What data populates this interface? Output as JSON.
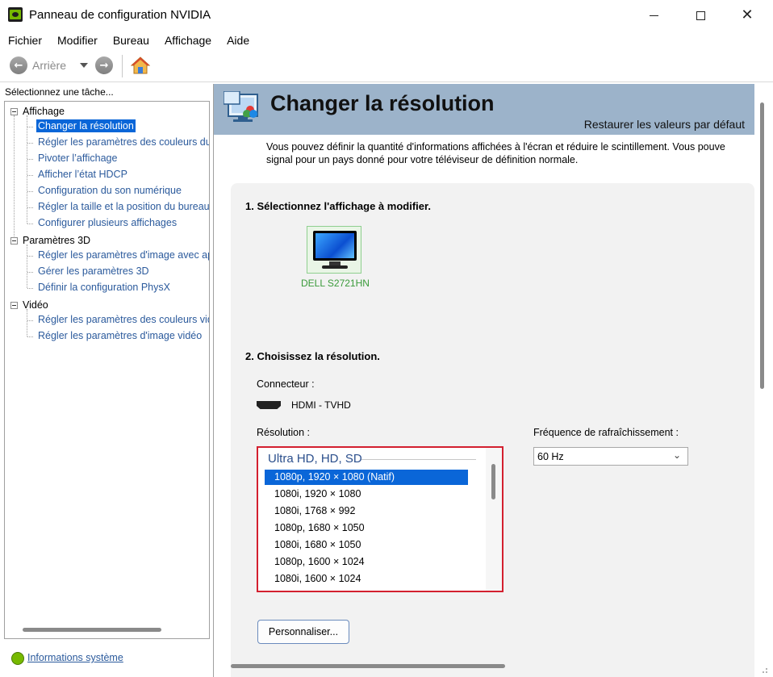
{
  "window": {
    "title": "Panneau de configuration NVIDIA",
    "minimize_icon": "minimize-icon",
    "maximize_icon": "maximize-icon",
    "close_icon": "close-icon"
  },
  "menu": [
    "Fichier",
    "Modifier",
    "Bureau",
    "Affichage",
    "Aide"
  ],
  "toolbar": {
    "back_label": "Arrière",
    "back_icon": "arrow-left-icon",
    "forward_icon": "arrow-right-icon",
    "home_icon": "home-icon"
  },
  "sidebar": {
    "header": "Sélectionnez une tâche...",
    "groups": [
      {
        "label": "Affichage",
        "items": [
          "Changer la résolution",
          "Régler les paramètres des couleurs du bureau",
          "Pivoter l’affichage",
          "Afficher l’état HDCP",
          "Configuration du son numérique",
          "Régler la taille et la position du bureau",
          "Configurer plusieurs affichages"
        ]
      },
      {
        "label": "Paramètres 3D",
        "items": [
          "Régler les paramètres d'image avec aperçu",
          "Gérer les paramètres 3D",
          "Définir la configuration PhysX"
        ]
      },
      {
        "label": "Vidéo",
        "items": [
          "Régler les paramètres des couleurs vidéo",
          "Régler les paramètres d'image vidéo"
        ]
      }
    ],
    "selected_item": "Changer la résolution",
    "system_info_link": "Informations système"
  },
  "main": {
    "title": "Changer la résolution",
    "restore_defaults": "Restaurer les valeurs par défaut",
    "intro_line1": "Vous pouvez définir la quantité d'informations affichées à l'écran et réduire le scintillement. Vous pouve",
    "intro_line2": "signal pour un pays donné pour votre téléviseur de définition normale.",
    "step1_title": "1. Sélectionnez l'affichage à modifier.",
    "display_name": "DELL S2721HN",
    "step2_title": "2. Choisissez la résolution.",
    "connector_label": "Connecteur :",
    "connector_value": "HDMI - TVHD",
    "resolution_label": "Résolution :",
    "resolution_group": "Ultra HD, HD, SD",
    "resolutions": [
      "1080p, 1920 × 1080 (Natif)",
      "1080i, 1920 × 1080",
      "1080i, 1768 × 992",
      "1080p, 1680 × 1050",
      "1080i, 1680 × 1050",
      "1080p, 1600 × 1024",
      "1080i, 1600 × 1024"
    ],
    "selected_resolution": "1080p, 1920 × 1080 (Natif)",
    "refresh_label": "Fréquence de rafraîchissement :",
    "refresh_value": "60 Hz",
    "customize_button": "Personnaliser..."
  },
  "colors": {
    "banner_bg": "#9cb3ca",
    "selection": "#0a66d8",
    "link": "#2b5a9c",
    "highlight_border": "#d3202f",
    "nvidia_green": "#76b900"
  }
}
